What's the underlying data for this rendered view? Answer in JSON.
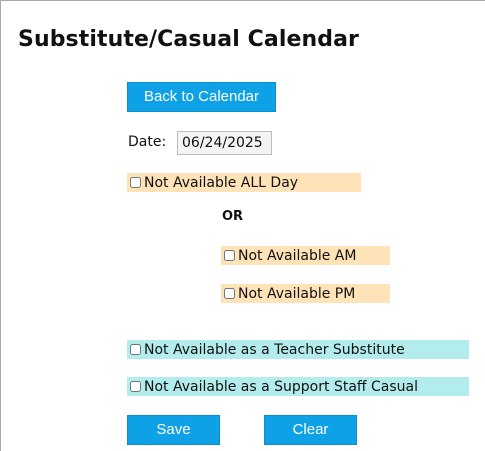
{
  "page": {
    "title": "Substitute/Casual Calendar"
  },
  "buttons": {
    "back_label": "Back to Calendar",
    "save_label": "Save",
    "clear_label": "Clear"
  },
  "date": {
    "label": "Date:",
    "value": "06/24/2025"
  },
  "options": {
    "all_day": {
      "label": "Not Available ALL Day",
      "checked": false
    },
    "separator": "OR",
    "am": {
      "label": "Not Available AM",
      "checked": false
    },
    "pm": {
      "label": "Not Available PM",
      "checked": false
    },
    "teacher": {
      "label": "Not Available as a Teacher Substitute",
      "checked": false
    },
    "support": {
      "label": "Not Available as a Support Staff Casual",
      "checked": false
    }
  },
  "colors": {
    "button_blue": "#0ea1e6",
    "peach": "#ffe3b8",
    "cyan": "#b3ecec"
  }
}
